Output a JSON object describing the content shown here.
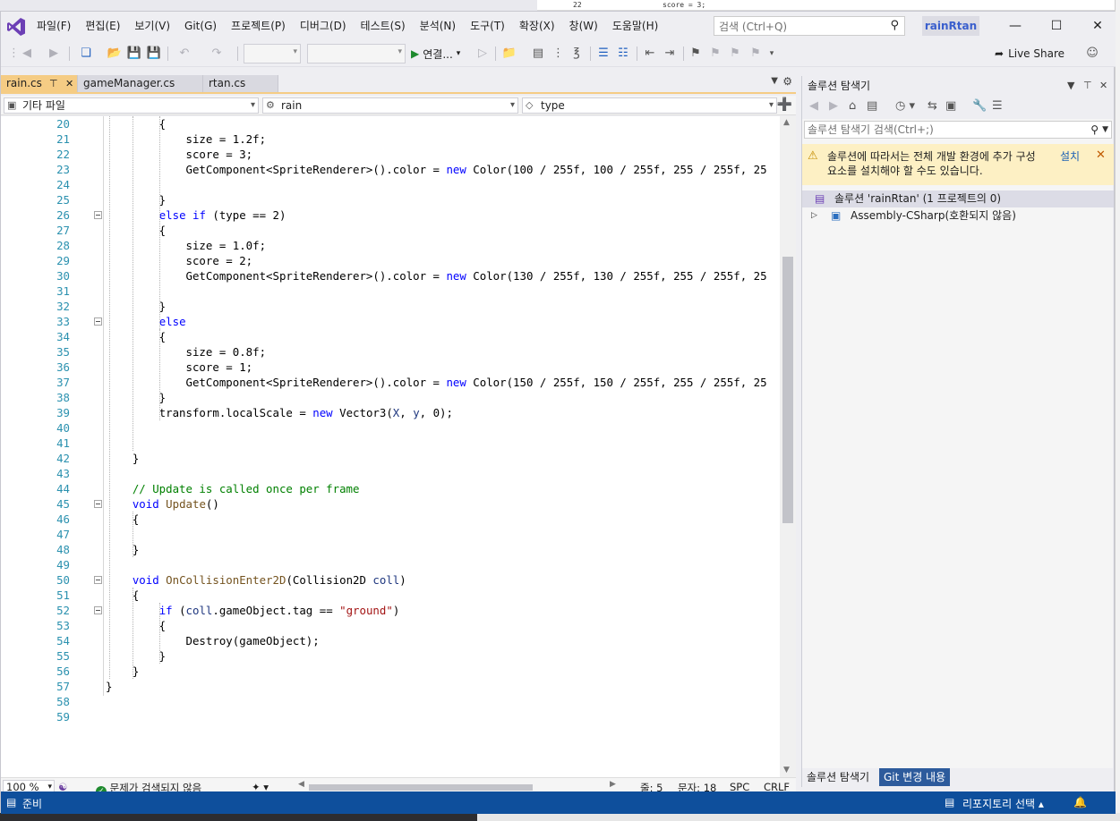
{
  "menu": [
    "파일(F)",
    "편집(E)",
    "보기(V)",
    "Git(G)",
    "프로젝트(P)",
    "디버그(D)",
    "테스트(S)",
    "분석(N)",
    "도구(T)",
    "확장(X)",
    "창(W)",
    "도움말(H)"
  ],
  "search": {
    "placeholder": "검색 (Ctrl+Q)"
  },
  "solution_name": "rainRtan",
  "toolbar": {
    "run_label": "연결...",
    "live_share": "Live Share"
  },
  "tabs": [
    {
      "label": "rain.cs",
      "active": true
    },
    {
      "label": "gameManager.cs",
      "active": false
    },
    {
      "label": "rtan.cs",
      "active": false
    }
  ],
  "navbar": {
    "project": "기타 파일",
    "class": "rain",
    "member": "type"
  },
  "code_lines": [
    {
      "n": "20",
      "t": "        {"
    },
    {
      "n": "21",
      "t": "            size = 1.2f;"
    },
    {
      "n": "22",
      "t": "            score = 3;"
    },
    {
      "n": "23",
      "t": "            GetComponent<SpriteRenderer>().color = new Color(100 / 255f, 100 / 255f, 255 / 255f, 25"
    },
    {
      "n": "24",
      "t": ""
    },
    {
      "n": "25",
      "t": "        }"
    },
    {
      "n": "26",
      "t": "        else if (type == 2)"
    },
    {
      "n": "27",
      "t": "        {"
    },
    {
      "n": "28",
      "t": "            size = 1.0f;"
    },
    {
      "n": "29",
      "t": "            score = 2;"
    },
    {
      "n": "30",
      "t": "            GetComponent<SpriteRenderer>().color = new Color(130 / 255f, 130 / 255f, 255 / 255f, 25"
    },
    {
      "n": "31",
      "t": ""
    },
    {
      "n": "32",
      "t": "        }"
    },
    {
      "n": "33",
      "t": "        else"
    },
    {
      "n": "34",
      "t": "        {"
    },
    {
      "n": "35",
      "t": "            size = 0.8f;"
    },
    {
      "n": "36",
      "t": "            score = 1;"
    },
    {
      "n": "37",
      "t": "            GetComponent<SpriteRenderer>().color = new Color(150 / 255f, 150 / 255f, 255 / 255f, 25"
    },
    {
      "n": "38",
      "t": "        }"
    },
    {
      "n": "39",
      "t": "        transform.localScale = new Vector3(X, y, 0);"
    },
    {
      "n": "40",
      "t": ""
    },
    {
      "n": "41",
      "t": ""
    },
    {
      "n": "42",
      "t": "    }"
    },
    {
      "n": "43",
      "t": ""
    },
    {
      "n": "44",
      "t": "    // Update is called once per frame"
    },
    {
      "n": "45",
      "t": "    void Update()"
    },
    {
      "n": "46",
      "t": "    {"
    },
    {
      "n": "47",
      "t": ""
    },
    {
      "n": "48",
      "t": "    }"
    },
    {
      "n": "49",
      "t": ""
    },
    {
      "n": "50",
      "t": "    void OnCollisionEnter2D(Collision2D coll)"
    },
    {
      "n": "51",
      "t": "    {"
    },
    {
      "n": "52",
      "t": "        if (coll.gameObject.tag == \"ground\")"
    },
    {
      "n": "53",
      "t": "        {"
    },
    {
      "n": "54",
      "t": "            Destroy(gameObject);"
    },
    {
      "n": "55",
      "t": "        }"
    },
    {
      "n": "56",
      "t": "    }"
    },
    {
      "n": "57",
      "t": "}"
    },
    {
      "n": "58",
      "t": ""
    },
    {
      "n": "59",
      "t": ""
    }
  ],
  "editor_status": {
    "zoom": "100 %",
    "issues": "문제가 검색되지 않음",
    "line": "줄: 5",
    "col": "문자: 18",
    "ws": "SPC",
    "eol": "CRLF"
  },
  "solution_explorer": {
    "title": "솔루션 탐색기",
    "search_placeholder": "솔루션 탐색기 검색(Ctrl+;)",
    "banner_message": "솔루션에 따라서는 전체 개발 환경에 추가 구성 요소를 설치해야 할 수도 있습니다.",
    "banner_link": "설치",
    "tree": [
      {
        "label": "솔루션 'rainRtan' (1 프로젝트의 0)"
      },
      {
        "label": "Assembly-CSharp(호환되지 않음)"
      }
    ],
    "bottom_tabs": [
      "솔루션 탐색기",
      "Git 변경 내용"
    ]
  },
  "background_window": {
    "line_number": "22",
    "code": "score = 3;"
  },
  "statusbar": {
    "ready": "준비",
    "repo": "리포지토리 선택"
  },
  "colors": {
    "accent_tab": "#f5cc84",
    "statusbar": "#0e4f9c",
    "keyword": "#0000ff",
    "comment": "#008000",
    "string": "#a31515"
  }
}
